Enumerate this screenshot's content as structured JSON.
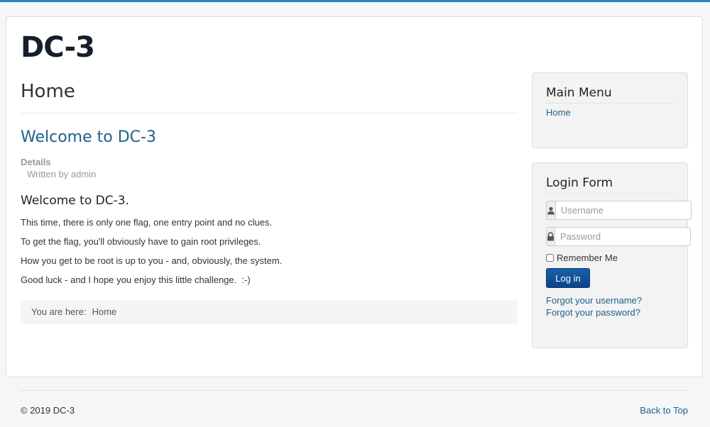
{
  "site": {
    "title": "DC-3"
  },
  "page": {
    "title": "Home"
  },
  "article": {
    "title": "Welcome to DC-3",
    "details_label": "Details",
    "written_by": "Written by admin",
    "heading": "Welcome to DC-3.",
    "paragraphs": [
      "This time, there is only one flag, one entry point and no clues.",
      "To get the flag, you'll obviously have to gain root privileges.",
      "How you get to be root is up to you - and, obviously, the system.",
      "Good luck - and I hope you enjoy this little challenge.  :-)"
    ]
  },
  "breadcrumb": {
    "prefix": "You are here:",
    "current": "Home"
  },
  "main_menu": {
    "title": "Main Menu",
    "items": [
      {
        "label": "Home"
      }
    ]
  },
  "login_form": {
    "title": "Login Form",
    "username_placeholder": "Username",
    "password_placeholder": "Password",
    "remember_label": "Remember Me",
    "login_button": "Log in",
    "forgot_username": "Forgot your username?",
    "forgot_password": "Forgot your password?",
    "icons": {
      "username": "user-icon",
      "password": "lock-icon"
    }
  },
  "footer": {
    "copyright": "© 2019 DC-3",
    "back_to_top": "Back to Top"
  },
  "colors": {
    "accent": "#2a85c8",
    "link": "#1f5f8b",
    "button": "#0b4489"
  }
}
